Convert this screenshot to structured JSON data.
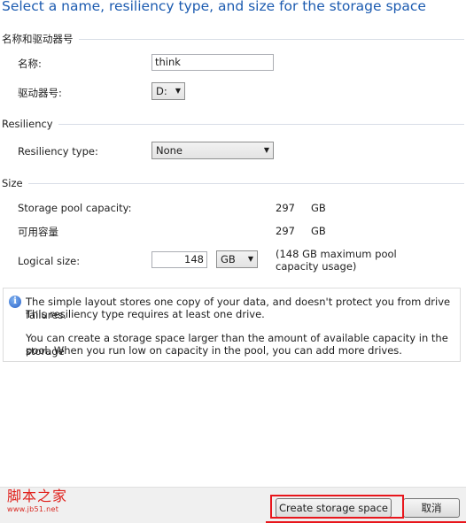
{
  "title": "Select a name, resiliency type, and size for the storage space",
  "name_section": {
    "heading": "名称和驱动器号",
    "name_label": "名称:",
    "name_value": "think",
    "drive_label": "驱动器号:",
    "drive_value": "D:"
  },
  "resiliency_section": {
    "heading": "Resiliency",
    "type_label": "Resiliency type:",
    "type_value": "None"
  },
  "size_section": {
    "heading": "Size",
    "pool_capacity_label": "Storage pool capacity:",
    "pool_capacity_value": "297",
    "pool_capacity_unit": "GB",
    "available_label": "可用容量",
    "available_value": "297",
    "available_unit": "GB",
    "logical_label": "Logical size:",
    "logical_value": "148",
    "logical_unit": "GB",
    "logical_note_line1": "(148 GB maximum pool",
    "logical_note_line2": "capacity usage)"
  },
  "info": {
    "icon": "info-icon",
    "line1": "The simple layout stores one copy of your data, and doesn't protect you from drive failures.",
    "line2": "This resiliency type requires at least one drive.",
    "line3": "You can create a storage space larger than the amount of available capacity in the storage",
    "line4": "pool. When you run low on capacity in the pool, you can add more drives."
  },
  "watermark": {
    "text": "脚本之家",
    "url": "www.jb51.net"
  },
  "buttons": {
    "create": "Create storage space",
    "cancel": "取消"
  },
  "colors": {
    "title": "#1c5bb0",
    "highlight": "#e8161c",
    "watermark": "#e0201b"
  }
}
